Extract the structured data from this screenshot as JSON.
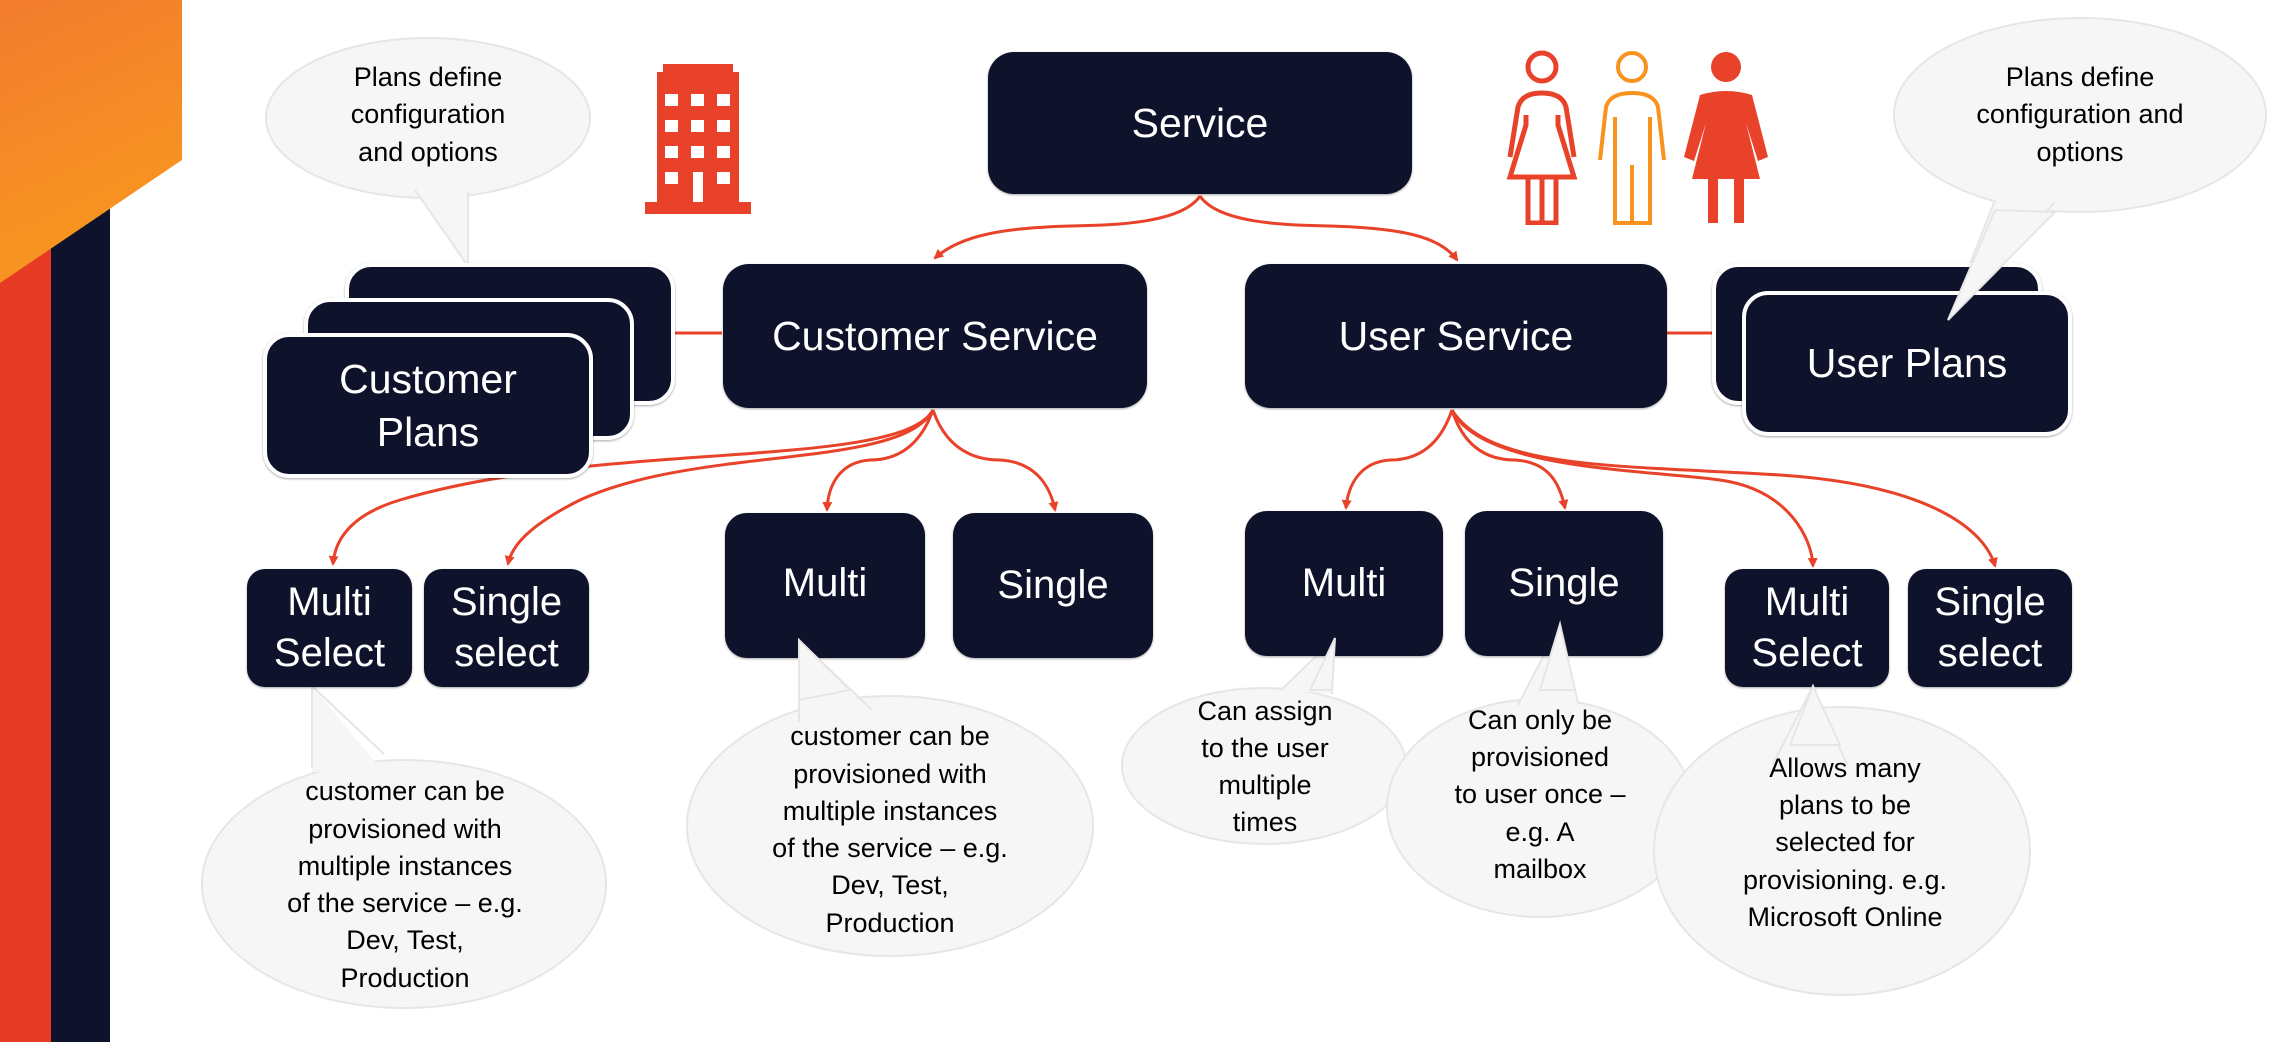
{
  "colors": {
    "node_fill": "#0E122A",
    "node_text": "#FFFFFF",
    "connector": "#E8432A",
    "bubble_fill": "#F6F6F6",
    "bubble_stroke": "#E6E6E6",
    "accent_orange": "#F58A2A",
    "accent_red": "#E63A24",
    "accent_navy": "#0E122A",
    "icon_red": "#E8432A",
    "icon_orange": "#F7931E"
  },
  "nodes": {
    "service": "Service",
    "customer_service": "Customer Service",
    "user_service": "User Service",
    "customer_plans": [
      "Customer",
      "Plans"
    ],
    "user_plans": "User Plans",
    "customer_plan_multi_select": [
      "Multi",
      "Select"
    ],
    "customer_plan_single_select": [
      "Single",
      "select"
    ],
    "customer_multi": "Multi",
    "customer_single": "Single",
    "user_multi": "Multi",
    "user_single": "Single",
    "user_plan_multi_select": [
      "Multi",
      "Select"
    ],
    "user_plan_single_select": [
      "Single",
      "select"
    ]
  },
  "callouts": {
    "customer_plans_note": [
      "Plans define",
      "configuration",
      "and options"
    ],
    "user_plans_note": [
      "Plans define",
      "configuration and",
      "options"
    ],
    "customer_multi_select_note": [
      "customer can be",
      "provisioned with",
      "multiple instances",
      "of the service – e.g.",
      "Dev, Test,",
      "Production"
    ],
    "customer_multi_note": [
      "customer can be",
      "provisioned with",
      "multiple instances",
      "of the service – e.g.",
      "Dev, Test,",
      "Production"
    ],
    "user_multi_note": [
      "Can assign",
      "to the user",
      "multiple",
      "times"
    ],
    "user_single_note": [
      "Can only be",
      "provisioned",
      "to user once –",
      "e.g. A",
      "mailbox"
    ],
    "user_multi_select_note": [
      "Allows many",
      "plans to be",
      "selected for",
      "provisioning. e.g.",
      "Microsoft Online"
    ]
  },
  "icons": {
    "customer": "building-icon",
    "users": [
      "woman-outline-icon",
      "man-outline-icon",
      "woman-filled-icon"
    ]
  }
}
